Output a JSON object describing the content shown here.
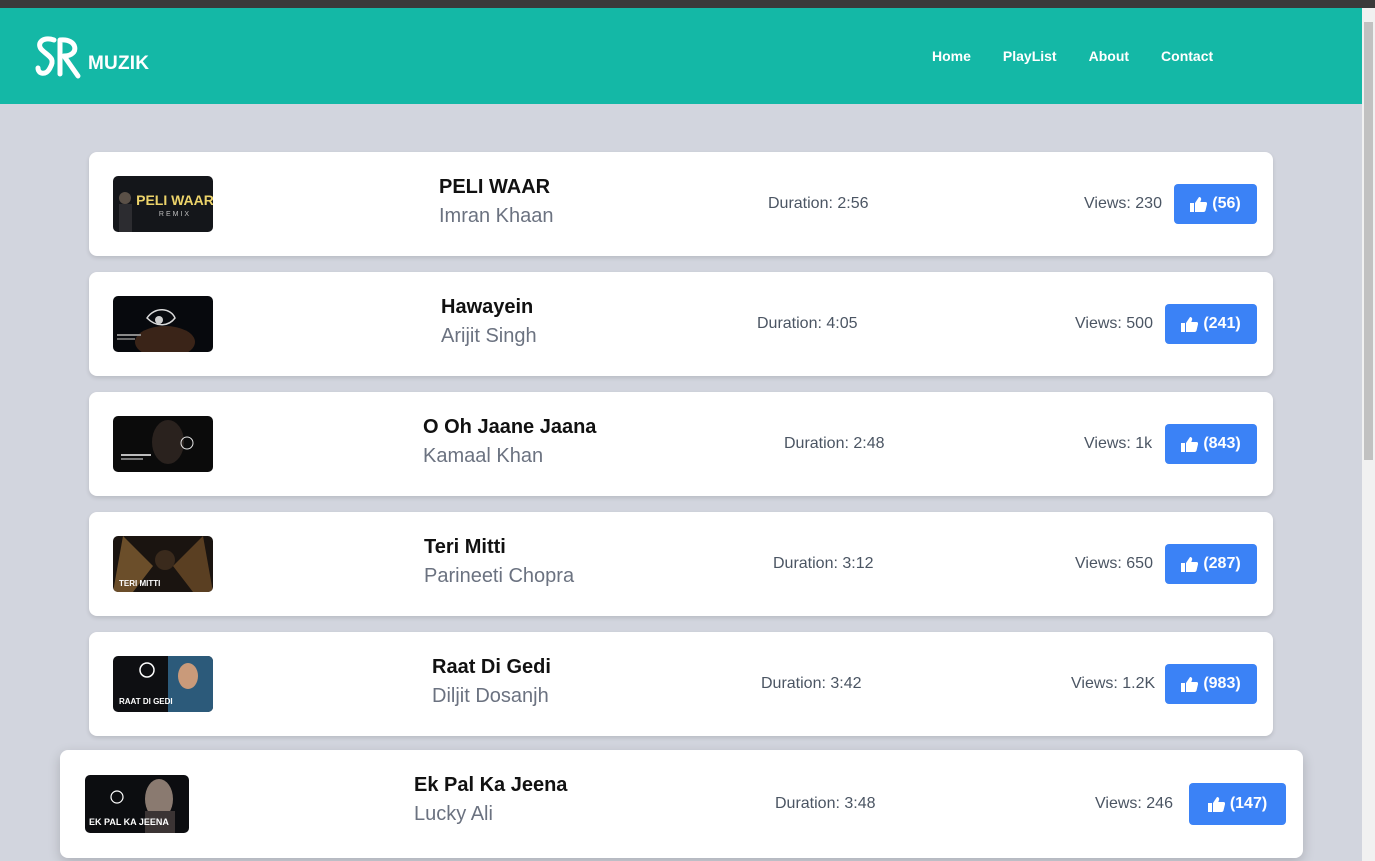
{
  "brand": {
    "name": "MUZIK"
  },
  "nav": [
    {
      "label": "Home"
    },
    {
      "label": "PlayList"
    },
    {
      "label": "About"
    },
    {
      "label": "Contact"
    }
  ],
  "icons": {
    "logo": "sr-logo-icon",
    "like": "thumbs-up-icon"
  },
  "colors": {
    "header": "#14b8a6",
    "like_button": "#3b82f6",
    "background": "#d2d5de"
  },
  "songs": [
    {
      "title": "PELI WAAR",
      "artist": "Imran Khaan",
      "duration": "Duration: 2:56",
      "views": "Views: 230",
      "likes": "(56)",
      "thumb_text": "PELI WAAR"
    },
    {
      "title": "Hawayein",
      "artist": "Arijit Singh",
      "duration": "Duration: 4:05",
      "views": "Views: 500",
      "likes": "(241)",
      "thumb_text": ""
    },
    {
      "title": "O Oh Jaane Jaana",
      "artist": "Kamaal Khan",
      "duration": "Duration: 2:48",
      "views": "Views: 1k",
      "likes": "(843)",
      "thumb_text": ""
    },
    {
      "title": "Teri Mitti",
      "artist": "Parineeti Chopra",
      "duration": "Duration: 3:12",
      "views": "Views: 650",
      "likes": "(287)",
      "thumb_text": "TERI MITTI"
    },
    {
      "title": "Raat Di Gedi",
      "artist": "Diljit Dosanjh",
      "duration": "Duration: 3:42",
      "views": "Views: 1.2K",
      "likes": "(983)",
      "thumb_text": "RAAT DI GEDI"
    },
    {
      "title": "Ek Pal Ka Jeena",
      "artist": "Lucky Ali",
      "duration": "Duration: 3:48",
      "views": "Views: 246",
      "likes": "(147)",
      "thumb_text": "EK PAL KA JEENA"
    }
  ]
}
